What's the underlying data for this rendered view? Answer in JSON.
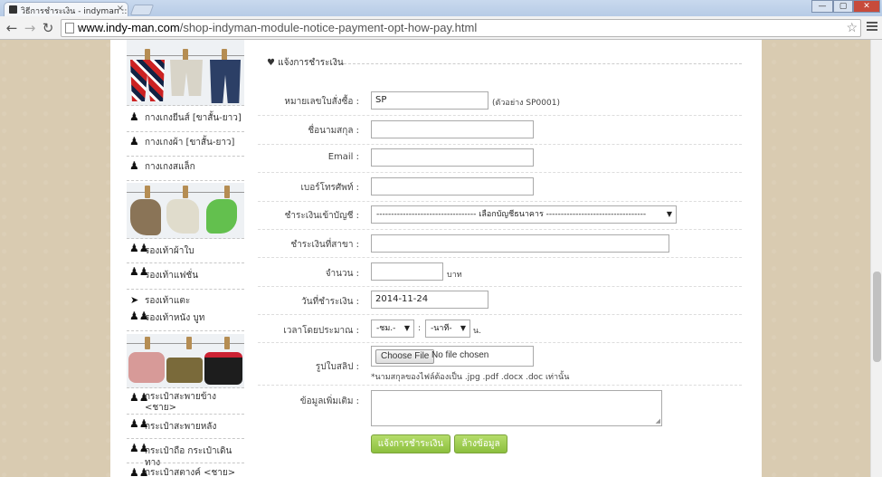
{
  "browser": {
    "tab_title": "วิธีการชำระเงิน - indyman ::",
    "url_domain": "www.indy-man.com",
    "url_path": "/shop-indyman-module-notice-payment-opt-how-pay.html",
    "window_controls": {
      "minimize": "—",
      "maximize": "▢",
      "close": "✕"
    }
  },
  "sidebar": {
    "items": [
      {
        "label": "กางเกงยีนส์ [ขาสั้น-ยาว]",
        "icon": "person-icon"
      },
      {
        "label": "กางเกงผ้า [ขาสั้น-ยาว]",
        "icon": "person-icon"
      },
      {
        "label": "กางเกงสแล็ก",
        "icon": "person-icon"
      },
      {
        "label": "รองเท้าผ้าใบ",
        "icon": "people-icon"
      },
      {
        "label": "รองเท้าแฟชั่น",
        "icon": "people-icon"
      },
      {
        "label": "รองเท้าแตะ",
        "icon": "arrow-circle-icon"
      },
      {
        "label": "รองเท้าหนัง บูท",
        "icon": "people-icon"
      },
      {
        "label": "กระเป๋าสะพายข้าง <ชาย>",
        "icon": "people-icon"
      },
      {
        "label": "กระเป๋าสะพายหลัง",
        "icon": "people-icon"
      },
      {
        "label": "กระเป๋าถือ กระเป๋าเดินทาง",
        "icon": "people-icon"
      },
      {
        "label": "กระเป๋าสตางค์ <ชาย>",
        "icon": "people-icon"
      }
    ]
  },
  "form": {
    "legend": "แจ้งการชำระเงิน",
    "legend_icon": "heart-icon",
    "order_no": {
      "label": "หมายเลขใบสั่งซื้อ :",
      "value": "SP",
      "hint": "(ตัวอย่าง SP0001)"
    },
    "name": {
      "label": "ชื่อนามสกุล :",
      "value": ""
    },
    "email": {
      "label": "Email :",
      "value": ""
    },
    "phone": {
      "label": "เบอร์โทรศัพท์ :",
      "value": ""
    },
    "account": {
      "label": "ชำระเงินเข้าบัญชี :",
      "selected": "---------------------------------- เลือกบัญชีธนาคาร ----------------------------------"
    },
    "branch": {
      "label": "ชำระเงินที่สาขา :",
      "value": ""
    },
    "amount": {
      "label": "จำนวน :",
      "value": "",
      "unit": "บาท"
    },
    "date": {
      "label": "วันที่ชำระเงิน :",
      "value": "2014-11-24"
    },
    "time": {
      "label": "เวลาโดยประมาณ :",
      "hour": "-ชม.-",
      "sep": ":",
      "minute": "-นาที-",
      "unit": "น."
    },
    "slip": {
      "label": "รูปใบสลิป :",
      "button": "Choose File",
      "status": "No file chosen",
      "note": "*นามสกุลของไฟล์ต้องเป็น .jpg .pdf .docx .doc เท่านั้น"
    },
    "extra": {
      "label": "ข้อมูลเพิ่มเติม :",
      "value": ""
    },
    "submit": "แจ้งการชำระเงิน",
    "reset": "ล้างข้อมูล"
  },
  "colors": {
    "button_green": "#8cbf3e",
    "page_bg": "#d9cbb1"
  }
}
